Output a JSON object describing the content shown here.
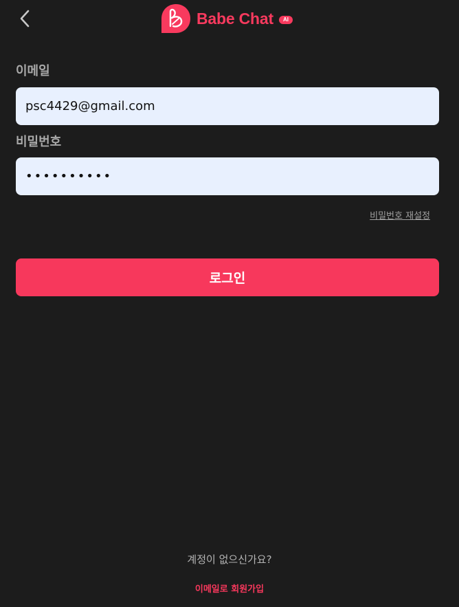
{
  "header": {
    "back_icon": "chevron-left-icon",
    "brand_name": "Babe Chat",
    "brand_badge": "AI",
    "brand_color": "#f83a5e"
  },
  "form": {
    "email_label": "이메일",
    "email_value": "psc4429@gmail.com",
    "password_label": "비밀번호",
    "password_value": "••••••••••",
    "reset_link": "비밀번호 재설정",
    "login_button": "로그인"
  },
  "footer": {
    "no_account_text": "계정이 없으신가요?",
    "signup_link": "이메일로 회원가입"
  },
  "colors": {
    "background": "#1c1c1c",
    "accent": "#f7385c",
    "input_background": "#e8f0fe"
  }
}
